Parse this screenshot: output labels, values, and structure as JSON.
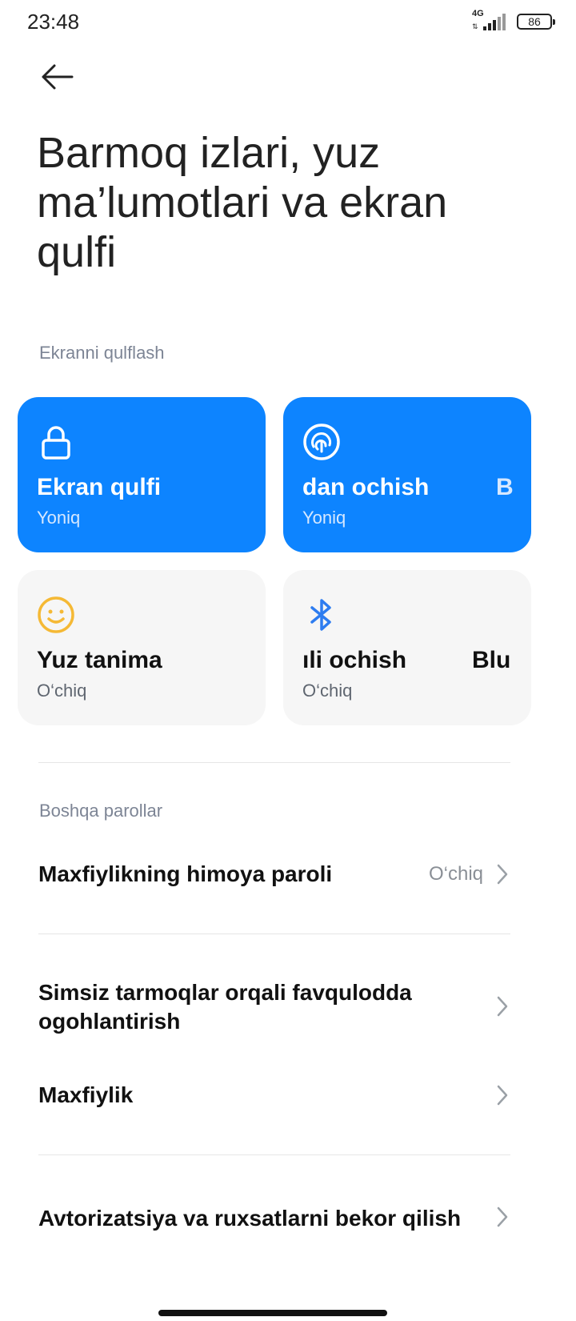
{
  "status_bar": {
    "time": "23:48",
    "network": "4G",
    "battery": "86"
  },
  "header": {
    "title": "Barmoq izlari, yuz ma’lumotlari va ekran qulfi"
  },
  "screen_lock_section": {
    "label": "Ekranni qulflash",
    "cards": [
      {
        "title": "Ekran qulfi",
        "status": "Yoniq"
      },
      {
        "title": "dan ochish",
        "title_fragment": "B",
        "status": "Yoniq"
      },
      {
        "title": "Yuz tanima",
        "status": "O‘chiq"
      },
      {
        "title": "ıli ochish",
        "title_fragment": "Blu",
        "status": "O‘chiq"
      }
    ]
  },
  "other_passwords_section": {
    "label": "Boshqa parollar",
    "items": [
      {
        "label": "Maxfiylikning himoya paroli",
        "value": "O‘chiq"
      }
    ]
  },
  "more_items": [
    {
      "label": "Simsiz tarmoqlar orqali favqulodda ogohlantirish"
    },
    {
      "label": "Maxfiylik"
    },
    {
      "label": "Avtorizatsiya va ruxsatlarni bekor qilish"
    }
  ],
  "colors": {
    "accent": "#0d84ff",
    "face_icon": "#f5b935",
    "bluetooth_icon": "#2d7cf0"
  }
}
